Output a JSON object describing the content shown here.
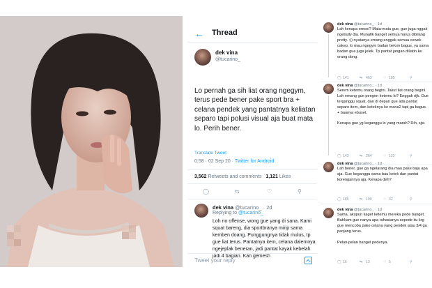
{
  "thread": {
    "header": {
      "back_icon": "arrow-left-icon",
      "title": "Thread"
    },
    "main_tweet": {
      "name": "dek vina",
      "handle": "@tucarino_",
      "text": "Lo pernah ga sih liat orang ngegym, terus pede bener pake sport bra + celana pendek yang pantatnya keliatan separo tapi polusi visual aja buat mata lo. Perih bener.",
      "translate": "Translate Tweet",
      "time": "0:58 · 02 Sep 20 · ",
      "via": "Twitter for Android",
      "retweets": "3,562",
      "retweets_label": "Retweets and comments",
      "likes": "1,121",
      "likes_label": "Likes"
    },
    "reply": {
      "name": "dek vina",
      "handle": "@tucarino_ · 2d",
      "replying_prefix": "Replying to ",
      "replying_to": "@tucarino_",
      "text": "Loh no offense, wong gue yang di sana. Kami squat bareng, dia sportbranya mirip sama kemben doang. Punggungnya tidak mulus, tp gue liat terus. Pantatnya item, celana dalemnya ngejeplak beneran, jadi pantat kayak kebelah jadi 4 bagian. Kan gemesh"
    },
    "compose_placeholder": "Tweet your reply"
  },
  "right_panel": {
    "tweets": [
      {
        "name": "dek vina",
        "handle": "@tucarino_ · 1d",
        "text": "Lah kenapa emosi? Mata-mata gue, gue juga nggak ngebully dia. Munafik banget semua harus dibilang pretty. :)) nyatanya emang enggak semua cewek cakep, lo mau ngegym badan belom bagus, ya sama badan gue juga jelek. Tp pantat jangan diliatin ke orang dong.",
        "replies": "141",
        "retweets": "463",
        "likes": "185"
      },
      {
        "name": "dek vina",
        "handle": "@tucarino_ · 1d",
        "text": "Serem ketemu orang begini. Takut liat orang begini. Lah emang gue pengen ketemu lo? Enggak rijk. Gue terganggu squat, dan di depan gue ada pantat separo item, dan keteknya ke mana2 tapi ga bagus. + bau­nya ebuset.\n\nKenapa gue yg keganggu lo yang marah? Dih, sjw.",
        "replies": "143",
        "retweets": "264",
        "likes": "122"
      },
      {
        "name": "dek vina",
        "handle": "@tucarino_ · 1d",
        "text": "Lah bener, gue ga ngelarang dia mau pake baju apa aja. Gue keganggu sama bau ketek dan pantat korengannya aja. Kenapa deh?",
        "replies": "185",
        "retweets": "199",
        "likes": "42"
      },
      {
        "name": "dek vina",
        "handle": "@tucarino_ · 1d",
        "text": "Sama, akupun kaget ketemu mereka pede banget. Bahkam gue nanya apa rahasianya sepede itu krg gue mencoba pake celana yang pendek atau 3/4 ga panjang terus.\n\nPelan-pelan banget pedenya.",
        "replies": "16",
        "retweets": "13",
        "likes": "5"
      }
    ]
  },
  "colors": {
    "accent": "#1da1f2",
    "text": "#14171a",
    "muted": "#657786",
    "divider": "#e6ecf0"
  },
  "icons": [
    "reply-icon",
    "retweet-icon",
    "like-icon",
    "share-icon",
    "image-icon"
  ]
}
